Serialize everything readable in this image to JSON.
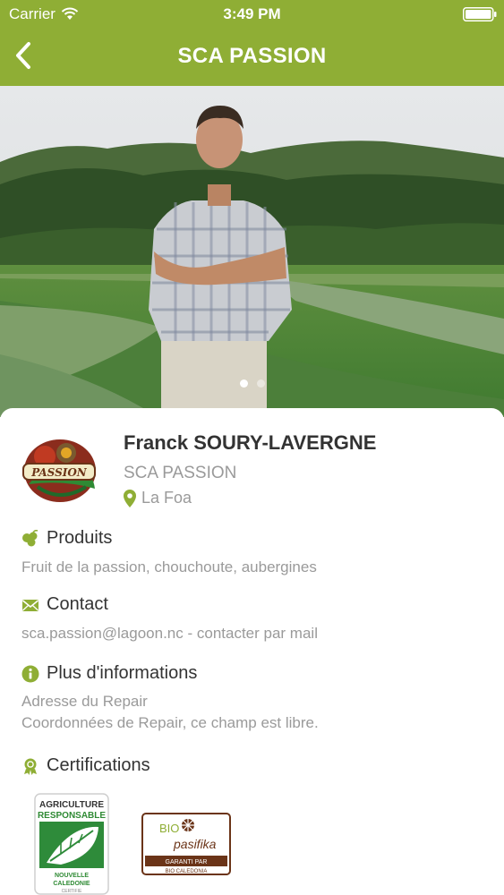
{
  "status_bar": {
    "carrier": "Carrier",
    "time": "3:49 PM"
  },
  "nav": {
    "title": "SCA PASSION",
    "back_icon": "chevron-left-icon"
  },
  "carousel": {
    "pages": 2,
    "current": 1
  },
  "producer": {
    "name": "Franck SOURY-LAVERGNE",
    "company": "SCA PASSION",
    "location": "La Foa",
    "logo_text": "PASSION"
  },
  "sections": {
    "products": {
      "title": "Produits",
      "text": "Fruit de la passion, chouchoute, aubergines",
      "icon": "fruits-icon"
    },
    "contact": {
      "title": "Contact",
      "text": "sca.passion@lagoon.nc - contacter par mail",
      "icon": "envelope-icon"
    },
    "info": {
      "title": "Plus d'informations",
      "line1": "Adresse du Repair",
      "line2": "Coordonnées de Repair, ce champ est libre.",
      "icon": "info-icon"
    },
    "certifications": {
      "title": "Certifications",
      "icon": "award-icon"
    }
  },
  "certs": {
    "agri": {
      "top": "AGRICULTURE",
      "mid": "RESPONSABLE",
      "bottom1": "NOUVELLE",
      "bottom2": "CALEDONIE",
      "bottom3": "CERTIFIE"
    },
    "bio": {
      "bio": "BIO",
      "name": "pasifika",
      "garanti": "GARANTI PAR",
      "org": "BIO CALEDONIA"
    }
  },
  "colors": {
    "brand_green": "#8fae35",
    "text_dark": "#333333",
    "text_muted": "#9a9a9a"
  }
}
